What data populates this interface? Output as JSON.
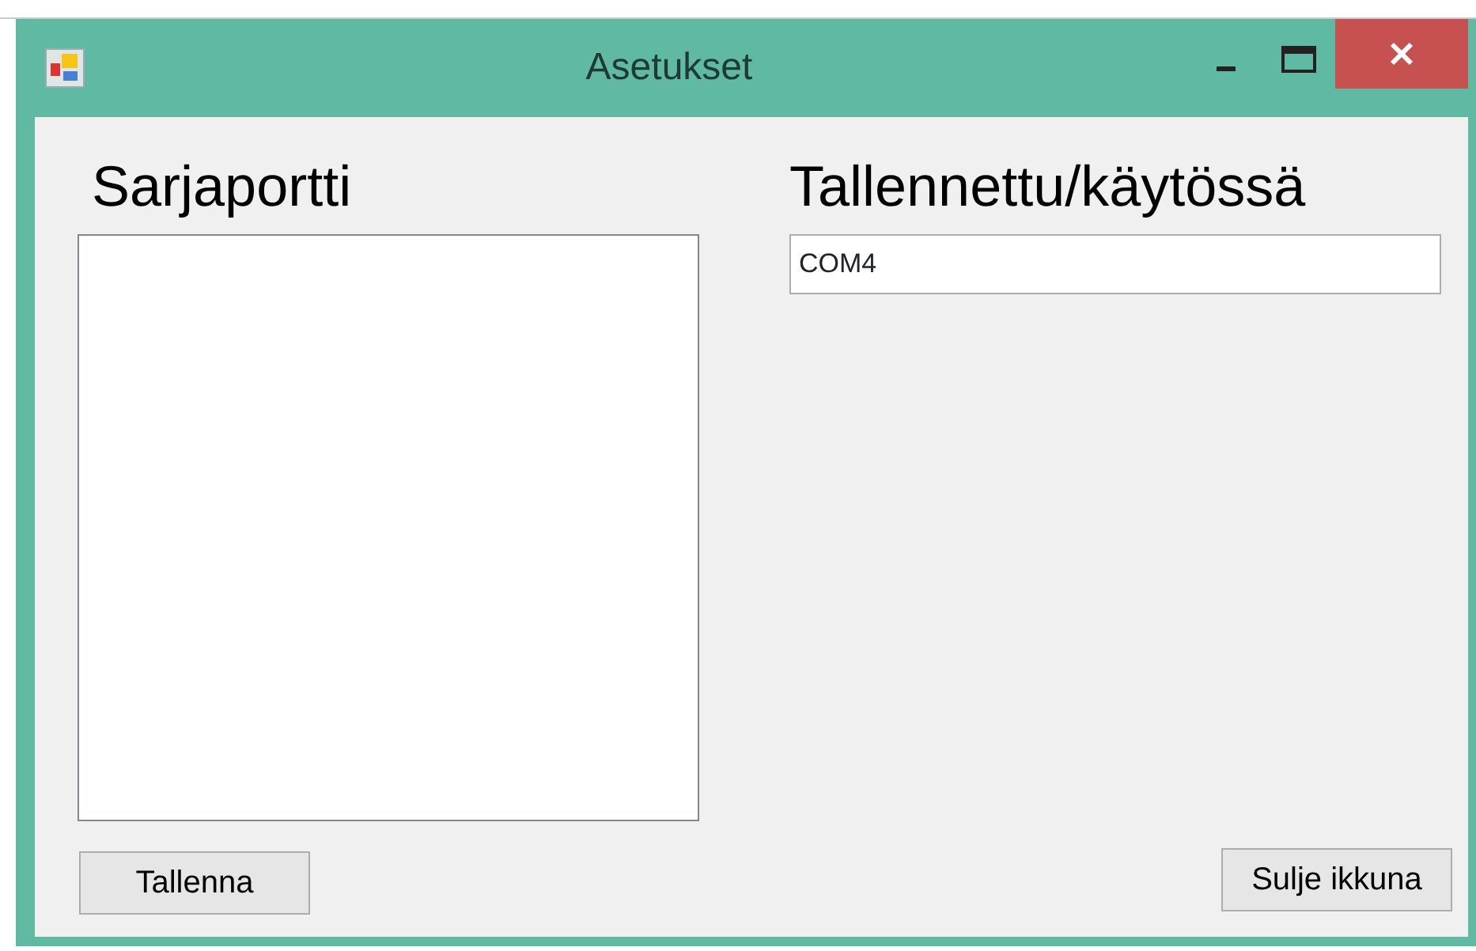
{
  "window": {
    "title": "Asetukset"
  },
  "serial_port": {
    "heading": "Sarjaportti"
  },
  "saved": {
    "heading": "Tallennettu/käytössä",
    "value": "COM4"
  },
  "buttons": [
    {
      "label": "Tallenna"
    },
    {
      "label": "Sulje ikkuna"
    }
  ]
}
